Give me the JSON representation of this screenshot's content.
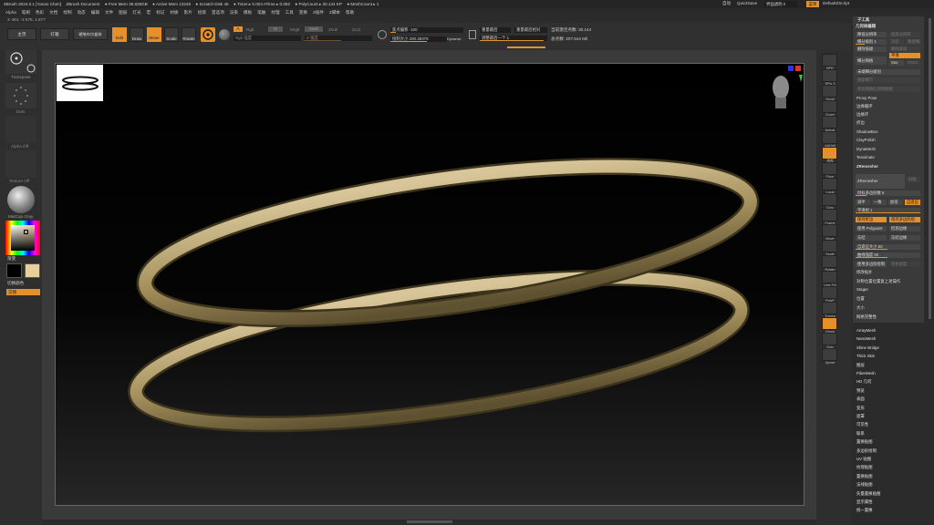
{
  "titlebar": {
    "app": "ZBrush 2024.0.1 [Yanao Chen]",
    "doc": "ZBrush Document",
    "free_mem": "● Free Mem 39.835GB",
    "active_mem": "● Active Mem 13249",
    "scratch": "● Scratch Disk 45",
    "timer": "● Timer ▸ 0.004 ATime ▸ 0.092",
    "polycount": "● PolyCount ▸ 30.144 KP",
    "meshcount": "● MeshCount ▸ 1",
    "ac": "自动",
    "quicksave": "QuickSave",
    "transparency": "界面透明 0",
    "menu_btn": "菜单",
    "default_script": "DefaultZScript"
  },
  "menubar": [
    "Alpha",
    "笔刷",
    "色彩",
    "文档",
    "绘制",
    "动态",
    "编辑",
    "文件",
    "图层",
    "灯光",
    "宏",
    "标记",
    "材质",
    "影片",
    "拾取",
    "首选项",
    "渲染",
    "模板",
    "笔触",
    "纹理",
    "工具",
    "变换",
    "Z插件",
    "Z脚本",
    "帮助"
  ],
  "coords": "X 404, -2 575, 1.577",
  "shelf": {
    "home": "主页",
    "lightbox": "灯箱",
    "spotlight": "硬笔布尔盒装",
    "edit": "Edit",
    "draw": "Draw",
    "move": "Move",
    "scale": "Scale",
    "rotate": "Rotate",
    "a_label": "A",
    "rgb": "Rgb",
    "m_label": "M",
    "mrgb": "Mrgb",
    "zsub": "Zsub",
    "zadd": "Zadd",
    "zcut": "Zcut",
    "rgb_intensity": "Rgb 强度",
    "z_intensity": "Z 强度",
    "focal_shift": "焦点偏移 -100",
    "draw_size": "绘制大小 280.28379",
    "dynamic": "Dynamic",
    "spotlight_btn": "重量最后",
    "spotlight_reach": "重量最后相对",
    "spotlight_fill": "调整最后一个 1",
    "active_points": "当前激活点数: 30,144",
    "total_points": "总点数: 207.644 Mil"
  },
  "left": {
    "transpose": "Transpose",
    "dots": "Dots",
    "alpha_off": "Alpha Off",
    "texture_off": "Texture Off",
    "matcap": "MatCap Gray",
    "gradient": "渐变",
    "switch_color": "切换颜色",
    "alternate": "交替"
  },
  "right_icons": [
    "BPR",
    "SPix 3",
    "Scroll",
    "Zoom",
    "Actual",
    "AAHalf",
    "透视",
    "Floor",
    "Local",
    "Gyro",
    "Frame",
    "Move",
    "Scale",
    "Rotate",
    "Line Fill",
    "PolyF",
    "Transp",
    "Ghost",
    "Solo",
    "Xpose"
  ],
  "tool_panel": {
    "header": "子工具",
    "geometry": "几何体编辑",
    "lower_res": "降低分辨率",
    "higher_res": "提高分辨率",
    "sdiv": "细分级别 1",
    "del_lower": "删除低级",
    "del_higher": "删除高级",
    "freeze": "冻结",
    "reconstruct": "重建细分",
    "convert_bpr": "转换 BPR",
    "divide": "细分网格",
    "smt": "平滑",
    "suv": "Suv",
    "rsmt": "RSmt",
    "crease": "未端细分级别",
    "repeat": "重复细节",
    "apply_sub": "将日期换应用到网格",
    "proxy_pose": "Proxy Pose",
    "edge_loop": "边缘循环",
    "crease_sub": "边缘环",
    "shell": "折边",
    "shadowbox": "ShadowBox",
    "claypolish": "ClayPolish",
    "dynamesh": "DynaMesh",
    "tessimate": "Tessimate",
    "zremesher_head": "ZRemesher",
    "zremesher_btn": "ZRemesher",
    "legacy": "旧版",
    "target_poly": "目标多边形数 5",
    "half": "减半",
    "same": "一致",
    "double": "加倍",
    "adaptive": "自适应",
    "adapt_size": "平滑组 1",
    "keep_groups": "保持折边",
    "keep_polygroups": "保持多边形组",
    "use_polypaint": "使用 Polypaint",
    "detect_edges": "检测边缘",
    "freeze_border": "冻结",
    "freeze_groups": "冻结边缘",
    "adapt_size_val": "自适应大小 50",
    "curve_strength": "曲线强度 50",
    "target_polygons": "使用多边形绘制",
    "paint_density": "单体密度",
    "modify_topo": "修改拓扑",
    "position": "对称位置位置复上述操作",
    "stager": "Stager",
    "sub_position": "位置",
    "size": "大小",
    "mesh_integrity": "网格完整性"
  },
  "sub_list": [
    "ArrayMesh",
    "NanoMesh",
    "Slime Bridge",
    "Thick Skin",
    "图层",
    "FiberMesh",
    "HD 几何",
    "预览",
    "表面",
    "变形",
    "遮罩",
    "可见性",
    "联系",
    "置换贴图",
    "多边形绘制",
    "UV 贴图",
    "纹理贴图",
    "置换贴图",
    "法线贴图",
    "矢量置换贴图",
    "显示属性",
    "统一置换"
  ],
  "colors": {
    "accent": "#e5902a",
    "ring": "#b29f73",
    "secondary": "#e9cf9a"
  }
}
